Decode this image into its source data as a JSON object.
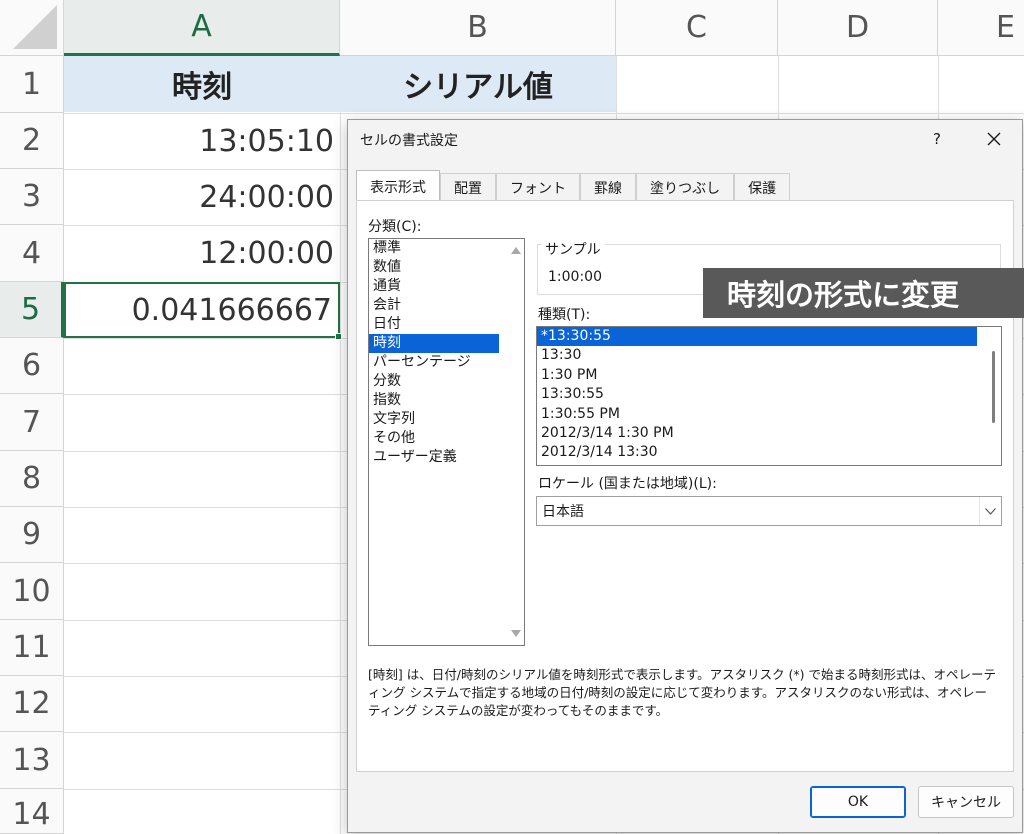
{
  "spreadsheet": {
    "columns": [
      "A",
      "B",
      "C",
      "D",
      "E"
    ],
    "rows": [
      "1",
      "2",
      "3",
      "4",
      "5",
      "6",
      "7",
      "8",
      "9",
      "10",
      "11",
      "12",
      "13",
      "14"
    ],
    "header_row": {
      "a": "時刻",
      "b": "シリアル値"
    },
    "cells": {
      "a2": "13:05:10",
      "a3": "24:00:00",
      "a4": "12:00:00",
      "a5": "0.041666667"
    },
    "active_cell": "A5",
    "colors": {
      "accent": "#217346",
      "header_fill": "#dde9f5"
    }
  },
  "dialog": {
    "title": "セルの書式設定",
    "help_label": "?",
    "close_icon": "close-icon",
    "tabs": [
      "表示形式",
      "配置",
      "フォント",
      "罫線",
      "塗りつぶし",
      "保護"
    ],
    "active_tab": "表示形式",
    "category_label": "分類(C):",
    "categories": [
      "標準",
      "数値",
      "通貨",
      "会計",
      "日付",
      "時刻",
      "パーセンテージ",
      "分数",
      "指数",
      "文字列",
      "その他",
      "ユーザー定義"
    ],
    "selected_category": "時刻",
    "sample_label": "サンプル",
    "sample_value": "1:00:00",
    "type_label": "種類(T):",
    "types": [
      "*13:30:55",
      "13:30",
      "1:30 PM",
      "13:30:55",
      "1:30:55 PM",
      "2012/3/14 1:30 PM",
      "2012/3/14 13:30"
    ],
    "selected_type": "*13:30:55",
    "locale_label": "ロケール (国または地域)(L):",
    "locale_value": "日本語",
    "description": "[時刻] は、日付/時刻のシリアル値を時刻形式で表示します。アスタリスク (*) で始まる時刻形式は、オペレーティング システムで指定する地域の日付/時刻の設定に応じて変わります。アスタリスクのない形式は、オペレーティング システムの設定が変わってもそのままです。",
    "ok_label": "OK",
    "cancel_label": "キャンセル",
    "colors": {
      "selection": "#0a64d8"
    }
  },
  "callout": {
    "text": "時刻の形式に変更"
  }
}
